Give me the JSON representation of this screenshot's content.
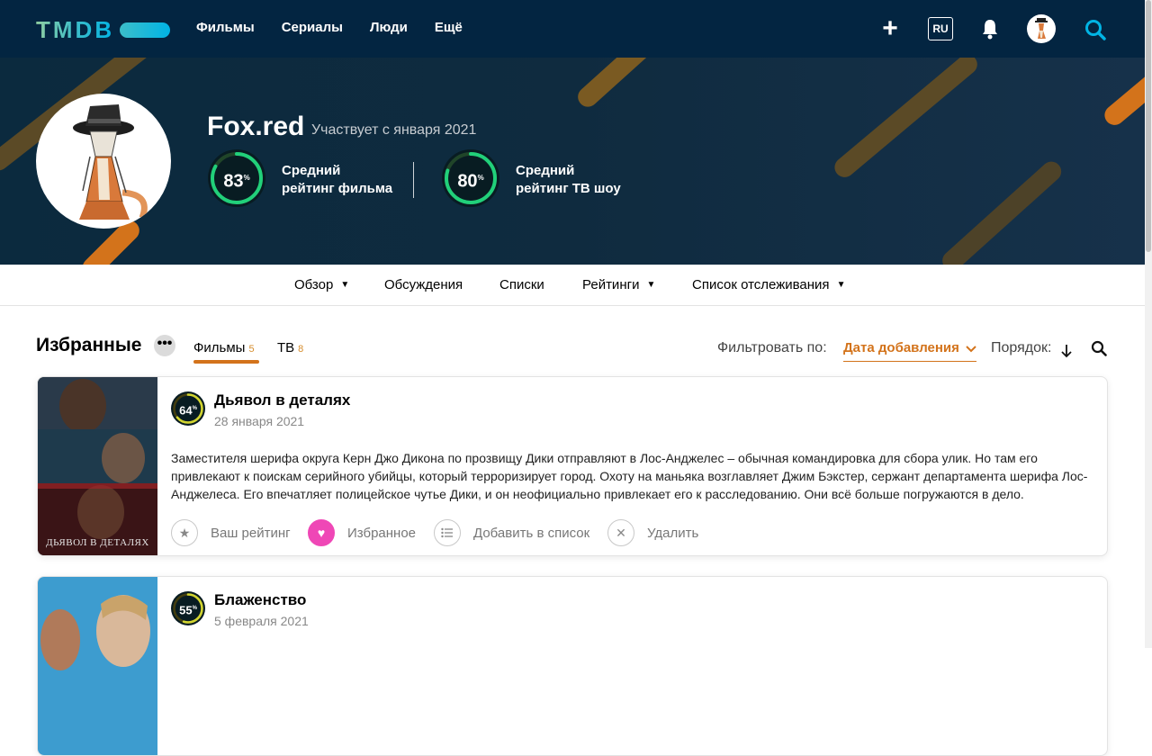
{
  "nav": {
    "logo": "TMDB",
    "links": [
      "Фильмы",
      "Сериалы",
      "Люди",
      "Ещё"
    ],
    "lang": "RU",
    "icons": [
      "plus-icon",
      "bell-icon",
      "search-icon"
    ]
  },
  "profile": {
    "username": "Fox.red",
    "member_since": "Участвует с января 2021",
    "movie_rating": {
      "value": 83,
      "pct": 0.83,
      "label_line1": "Средний",
      "label_line2": "рейтинг фильма"
    },
    "tv_rating": {
      "value": 80,
      "pct": 0.8,
      "label_line1": "Средний",
      "label_line2": "рейтинг ТВ шоу"
    }
  },
  "subnav": {
    "items": [
      "Обзор",
      "Обсуждения",
      "Списки",
      "Рейтинги",
      "Список отслеживания"
    ]
  },
  "favorites": {
    "title": "Избранные",
    "tabs": [
      {
        "label": "Фильмы",
        "count": "5"
      },
      {
        "label": "ТВ",
        "count": "8"
      }
    ],
    "filter_label": "Фильтровать по:",
    "filter_value": "Дата добавления",
    "order_label": "Порядок:"
  },
  "cards": [
    {
      "title": "Дьявол в деталях",
      "date": "28 января 2021",
      "score": 64,
      "score_pct": 0.64,
      "poster_caption": "ДЬЯВОЛ В ДЕТАЛЯХ",
      "overview": "Заместителя шерифа округа Керн Джо Дикона по прозвищу Дики отправляют в Лос-Анджелес – обычная командировка для сбора улик. Но там его привлекают к поискам серийного убийцы, который терроризирует город. Охоту на маньяка возглавляет Джим Бэкстер, сержант департамента шерифа Лос-Анджелеса. Его впечатляет полицейское чутье Дики, и он неофициально привлекает его к расследованию. Они всё больше погружаются в дело.",
      "actions": [
        "Ваш рейтинг",
        "Избранное",
        "Добавить в список",
        "Удалить"
      ]
    },
    {
      "title": "Блаженство",
      "date": "5 февраля 2021",
      "score": 55,
      "score_pct": 0.55
    }
  ],
  "colors": {
    "nav_bg": "#032541",
    "accent_orange": "#d3731b",
    "rating_green": "#21d07a",
    "rating_yellow": "#d2d531",
    "favorite_pink": "#ef47b6"
  }
}
